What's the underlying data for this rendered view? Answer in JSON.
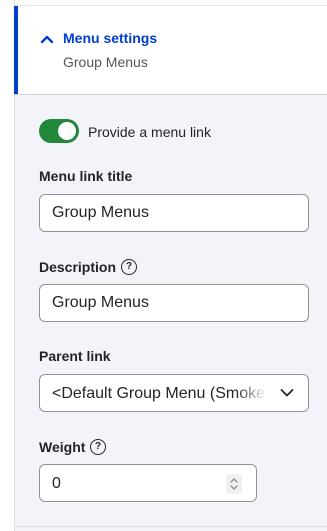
{
  "menu_settings": {
    "title": "Menu settings",
    "summary": "Group Menus"
  },
  "provide_menu_link": {
    "label": "Provide a menu link",
    "checked": true
  },
  "menu_link_title": {
    "label": "Menu link title",
    "value": "Group Menus"
  },
  "description": {
    "label": "Description",
    "help_icon": "question-circle-icon",
    "value": "Group Menus"
  },
  "parent_link": {
    "label": "Parent link",
    "selected": "<Default Group Menu (Smoke Test)>",
    "dropdown_icon": "chevron-down-icon"
  },
  "weight": {
    "label": "Weight",
    "help_icon": "question-circle-icon",
    "value": "0"
  },
  "colors": {
    "accent": "#003ecc",
    "toggle_on": "#228738",
    "body_bg": "#f3f4f9",
    "input_border": "#919297"
  }
}
